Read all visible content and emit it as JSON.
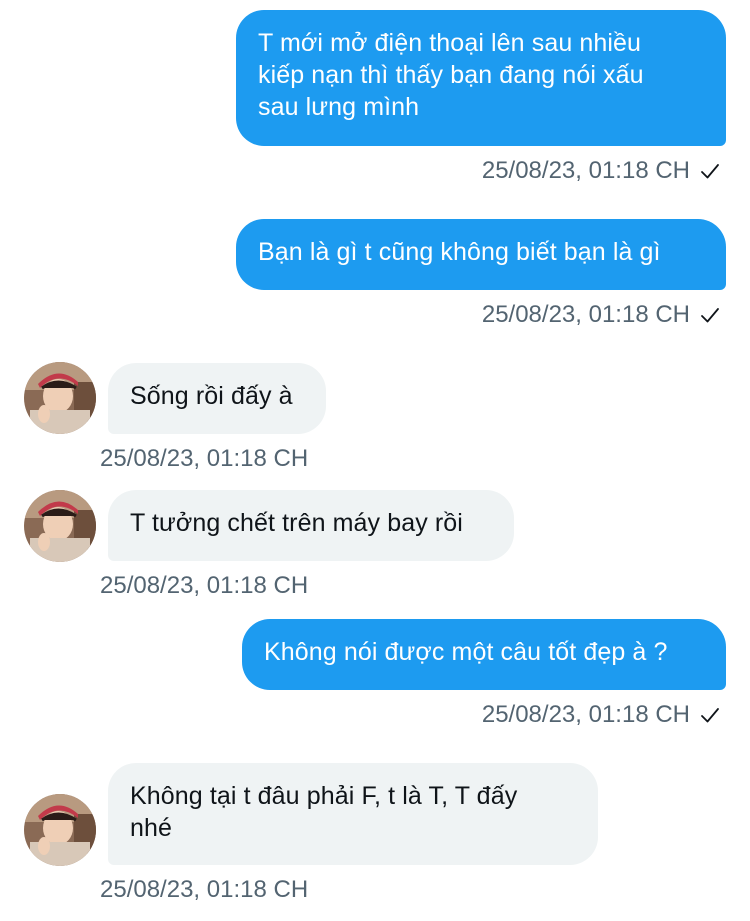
{
  "messages": [
    {
      "direction": "out",
      "text": "T mới mở điện thoại lên sau nhiều\nkiếp nạn thì thấy bạn đang nói xấu\nsau lưng mình",
      "time": "25/08/23, 01:18 CH",
      "status_icon": "checkmark-icon"
    },
    {
      "direction": "out",
      "text": "Bạn là gì t cũng không biết bạn là gì",
      "time": "25/08/23, 01:18 CH",
      "status_icon": "checkmark-icon"
    },
    {
      "direction": "in",
      "text": "Sống rồi đấy à",
      "time": "25/08/23, 01:18 CH"
    },
    {
      "direction": "in",
      "text": "T tưởng chết trên máy bay rồi",
      "time": "25/08/23, 01:18 CH"
    },
    {
      "direction": "out",
      "text": "Không nói được một câu tốt đẹp à ?",
      "time": "25/08/23, 01:18 CH",
      "status_icon": "checkmark-icon"
    },
    {
      "direction": "in",
      "text": "Không tại t đâu phải F, t là T, T đấy\nnhé",
      "time": "25/08/23, 01:18 CH"
    }
  ],
  "colors": {
    "outgoing_bubble": "#1d9bf0",
    "incoming_bubble": "#eff3f4",
    "timestamp": "#536471"
  },
  "avatar_icon": "user-photo-avatar"
}
